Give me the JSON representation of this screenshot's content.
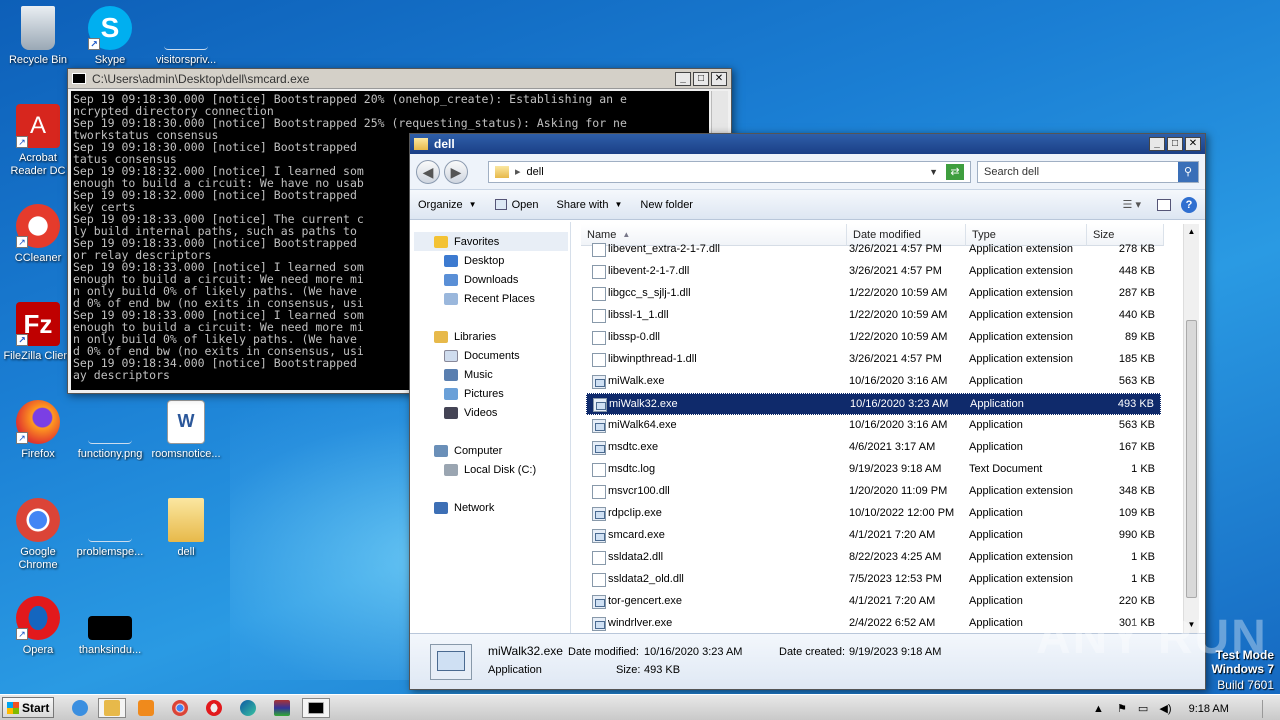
{
  "desktop": {
    "icons": [
      {
        "label": "Recycle Bin"
      },
      {
        "label": "Skype"
      },
      {
        "label": "visitorspriv..."
      },
      {
        "label": "Acrobat Reader DC"
      },
      {
        "label": "CCleaner"
      },
      {
        "label": "FileZilla Client"
      },
      {
        "label": "Firefox"
      },
      {
        "label": "functiony.png"
      },
      {
        "label": "roomsnotice..."
      },
      {
        "label": "Google Chrome"
      },
      {
        "label": "problemspe..."
      },
      {
        "label": "dell"
      },
      {
        "label": "Opera"
      },
      {
        "label": "thanksindu..."
      }
    ],
    "watermark": {
      "line1": "Test Mode",
      "line2": "Windows 7",
      "line3": "Build 7601"
    },
    "brand": "ANY RUN"
  },
  "console": {
    "title": "C:\\Users\\admin\\Desktop\\dell\\smcard.exe",
    "text": "Sep 19 09:18:30.000 [notice] Bootstrapped 20% (onehop_create): Establishing an e\nncrypted directory connection\nSep 19 09:18:30.000 [notice] Bootstrapped 25% (requesting_status): Asking for ne\ntworkstatus consensus\nSep 19 09:18:30.000 [notice] Bootstrapped\ntatus consensus\nSep 19 09:18:32.000 [notice] I learned som\nenough to build a circuit: We have no usab\nSep 19 09:18:32.000 [notice] Bootstrapped\nkey certs\nSep 19 09:18:33.000 [notice] The current c\nly build internal paths, such as paths to\nSep 19 09:18:33.000 [notice] Bootstrapped\nor relay descriptors\nSep 19 09:18:33.000 [notice] I learned som\nenough to build a circuit: We need more mi\nn only build 0% of likely paths. (We have\nd 0% of end bw (no exits in consensus, usi\nSep 19 09:18:33.000 [notice] I learned som\nenough to build a circuit: We need more mi\nn only build 0% of likely paths. (We have\nd 0% of end bw (no exits in consensus, usi\nSep 19 09:18:34.000 [notice] Bootstrapped\nay descriptors"
  },
  "explorer": {
    "title": "dell",
    "address": "dell",
    "search_placeholder": "Search dell",
    "toolbar": {
      "organize": "Organize",
      "open": "Open",
      "share_with": "Share with",
      "new_folder": "New folder"
    },
    "nav": {
      "favorites": "Favorites",
      "desktop": "Desktop",
      "downloads": "Downloads",
      "recent": "Recent Places",
      "libraries": "Libraries",
      "documents": "Documents",
      "music": "Music",
      "pictures": "Pictures",
      "videos": "Videos",
      "computer": "Computer",
      "local_disk": "Local Disk (C:)",
      "network": "Network"
    },
    "columns": {
      "name": "Name",
      "date": "Date modified",
      "type": "Type",
      "size": "Size"
    },
    "files": [
      {
        "name": "libevent_extra-2-1-7.dll",
        "date": "3/26/2021 4:57 PM",
        "type": "Application extension",
        "size": "278 KB",
        "kind": "dll"
      },
      {
        "name": "libevent-2-1-7.dll",
        "date": "3/26/2021 4:57 PM",
        "type": "Application extension",
        "size": "448 KB",
        "kind": "dll"
      },
      {
        "name": "libgcc_s_sjlj-1.dll",
        "date": "1/22/2020 10:59 AM",
        "type": "Application extension",
        "size": "287 KB",
        "kind": "dll"
      },
      {
        "name": "libssl-1_1.dll",
        "date": "1/22/2020 10:59 AM",
        "type": "Application extension",
        "size": "440 KB",
        "kind": "dll"
      },
      {
        "name": "libssp-0.dll",
        "date": "1/22/2020 10:59 AM",
        "type": "Application extension",
        "size": "89 KB",
        "kind": "dll"
      },
      {
        "name": "libwinpthread-1.dll",
        "date": "3/26/2021 4:57 PM",
        "type": "Application extension",
        "size": "185 KB",
        "kind": "dll"
      },
      {
        "name": "miWalk.exe",
        "date": "10/16/2020 3:16 AM",
        "type": "Application",
        "size": "563 KB",
        "kind": "exe"
      },
      {
        "name": "miWalk32.exe",
        "date": "10/16/2020 3:23 AM",
        "type": "Application",
        "size": "493 KB",
        "kind": "exe",
        "selected": true
      },
      {
        "name": "miWalk64.exe",
        "date": "10/16/2020 3:16 AM",
        "type": "Application",
        "size": "563 KB",
        "kind": "exe"
      },
      {
        "name": "msdtc.exe",
        "date": "4/6/2021 3:17 AM",
        "type": "Application",
        "size": "167 KB",
        "kind": "exe"
      },
      {
        "name": "msdtc.log",
        "date": "9/19/2023 9:18 AM",
        "type": "Text Document",
        "size": "1 KB",
        "kind": "txt"
      },
      {
        "name": "msvcr100.dll",
        "date": "1/20/2020 11:09 PM",
        "type": "Application extension",
        "size": "348 KB",
        "kind": "dll"
      },
      {
        "name": "rdpcIip.exe",
        "date": "10/10/2022 12:00 PM",
        "type": "Application",
        "size": "109 KB",
        "kind": "exe"
      },
      {
        "name": "smcard.exe",
        "date": "4/1/2021 7:20 AM",
        "type": "Application",
        "size": "990 KB",
        "kind": "exe"
      },
      {
        "name": "ssldata2.dll",
        "date": "8/22/2023 4:25 AM",
        "type": "Application extension",
        "size": "1 KB",
        "kind": "dll"
      },
      {
        "name": "ssldata2_old.dll",
        "date": "7/5/2023 12:53 PM",
        "type": "Application extension",
        "size": "1 KB",
        "kind": "dll"
      },
      {
        "name": "tor-gencert.exe",
        "date": "4/1/2021 7:20 AM",
        "type": "Application",
        "size": "220 KB",
        "kind": "exe"
      },
      {
        "name": "windrlver.exe",
        "date": "2/4/2022 6:52 AM",
        "type": "Application",
        "size": "301 KB",
        "kind": "exe"
      }
    ],
    "details": {
      "name": "miWalk32.exe",
      "type": "Application",
      "modified_label": "Date modified:",
      "modified": "10/16/2020 3:23 AM",
      "created_label": "Date created:",
      "created": "9/19/2023 9:18 AM",
      "size_label": "Size:",
      "size": "493 KB"
    }
  },
  "taskbar": {
    "start": "Start",
    "clock": "9:18 AM"
  }
}
